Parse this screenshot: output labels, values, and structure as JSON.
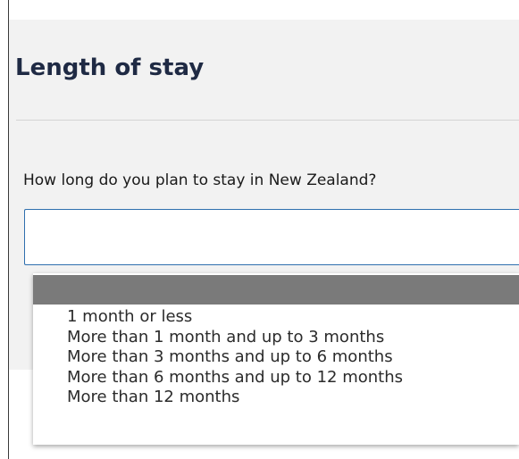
{
  "section": {
    "title": "Length of stay"
  },
  "question": {
    "label": "How long do you plan to stay in New Zealand?",
    "selected_value": ""
  },
  "dropdown": {
    "highlighted_option": "",
    "options": [
      "1 month or less",
      "More than 1 month and up to 3 months",
      "More than 3 months and up to 6 months",
      "More than 6 months and up to 12 months",
      "More than 12 months"
    ]
  },
  "colors": {
    "title_text": "#1f2a44",
    "select_border": "#2f6fae",
    "highlight_bar": "#7a7a7a",
    "panel_background": "#f2f2f2"
  }
}
